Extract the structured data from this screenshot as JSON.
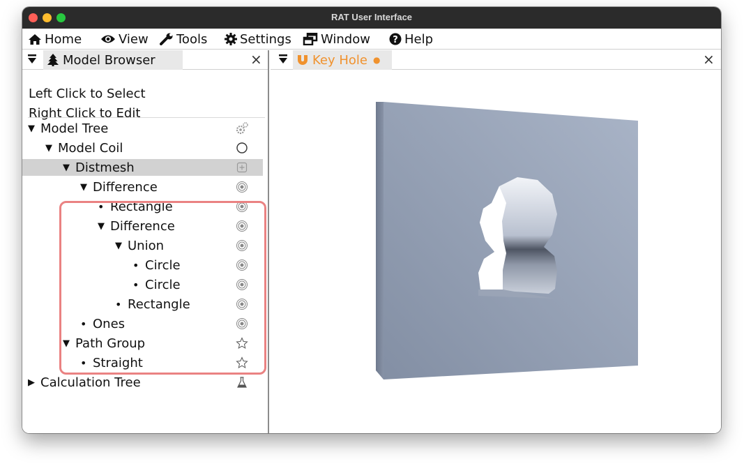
{
  "window": {
    "title": "RAT User Interface"
  },
  "menu": [
    {
      "name": "menu-home",
      "icon": "home-icon",
      "label": "Home"
    },
    {
      "name": "menu-view",
      "icon": "eye-icon",
      "label": "View"
    },
    {
      "name": "menu-tools",
      "icon": "wrench-icon",
      "label": "Tools"
    },
    {
      "name": "menu-settings",
      "icon": "gear-icon",
      "label": "Settings"
    },
    {
      "name": "menu-window",
      "icon": "window-restore-icon",
      "label": "Window"
    },
    {
      "name": "menu-help",
      "icon": "question-circle-icon",
      "label": "Help"
    }
  ],
  "browser": {
    "tab_label": "Model Browser",
    "tab_icon": "tree-icon",
    "hint_select": "Left Click to Select",
    "hint_edit": "Right Click to Edit"
  },
  "tree": [
    {
      "label": "Model Tree",
      "marker": "expanded",
      "icon": "gears-icon"
    },
    {
      "label": "Model Coil",
      "marker": "expanded",
      "icon": "circle-outline-icon"
    },
    {
      "label": "Distmesh",
      "marker": "expanded",
      "icon": "plus-square-icon",
      "selected": true
    },
    {
      "label": "Difference",
      "marker": "expanded",
      "icon": "bullseye-icon"
    },
    {
      "label": "Rectangle",
      "marker": "bullet",
      "icon": "bullseye-icon"
    },
    {
      "label": "Difference",
      "marker": "expanded",
      "icon": "bullseye-icon"
    },
    {
      "label": "Union",
      "marker": "expanded",
      "icon": "bullseye-icon"
    },
    {
      "label": "Circle",
      "marker": "bullet",
      "icon": "bullseye-icon"
    },
    {
      "label": "Circle",
      "marker": "bullet",
      "icon": "bullseye-icon"
    },
    {
      "label": "Rectangle",
      "marker": "bullet",
      "icon": "bullseye-icon"
    },
    {
      "label": "Ones",
      "marker": "bullet",
      "icon": "bullseye-icon"
    },
    {
      "label": "Path Group",
      "marker": "expanded",
      "icon": "star-outline-icon"
    },
    {
      "label": "Straight",
      "marker": "bullet",
      "icon": "star-outline-icon"
    },
    {
      "label": "Calculation Tree",
      "marker": "collapsed",
      "icon": "flask-icon"
    }
  ],
  "viewer": {
    "tab_label": "Key Hole",
    "tab_icon": "magnet-icon",
    "tab_modified_dot": "●"
  },
  "colors": {
    "accent": "#f0922e",
    "highlight_outline": "#ea8282",
    "selected_row": "#d2d2d2",
    "model_face": "#8f9cb2"
  }
}
